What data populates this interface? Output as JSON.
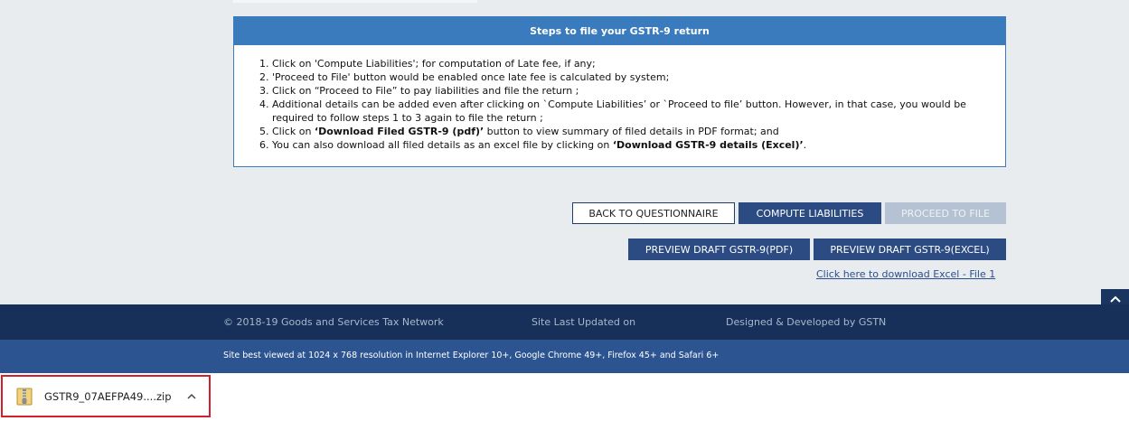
{
  "steps": {
    "title": "Steps to file your GSTR-9 return",
    "items": [
      {
        "pre": "Click on 'Compute Liabilities'; for computation of Late fee, if any;",
        "bold": "",
        "post": "",
        "bold2": "",
        "post2": ""
      },
      {
        "pre": "'Proceed to File' button would be enabled once late fee is calculated by system;",
        "bold": "",
        "post": "",
        "bold2": "",
        "post2": ""
      },
      {
        "pre": "Click on “Proceed to File” to pay liabilities and file the return ;",
        "bold": "",
        "post": "",
        "bold2": "",
        "post2": ""
      },
      {
        "pre": "Additional details can be added even after clicking on `Compute Liabilities’ or `Proceed to file’ button. However, in that case, you would be required to follow steps 1 to 3 again to file the return ;",
        "bold": "",
        "post": "",
        "bold2": "",
        "post2": ""
      },
      {
        "pre": "Click on ",
        "bold": "‘Download Filed GSTR-9 (pdf)’",
        "post": " button to view summary of filed details in PDF format; and",
        "bold2": "",
        "post2": ""
      },
      {
        "pre": "You can also download all filed details as an excel file by clicking on ",
        "bold": "‘Download GSTR-9 details (Excel)’",
        "post": ".",
        "bold2": "",
        "post2": ""
      }
    ]
  },
  "buttons": {
    "back": "BACK TO QUESTIONNAIRE",
    "compute": "COMPUTE LIABILITIES",
    "proceed": "PROCEED TO FILE",
    "preview_pdf": "PREVIEW DRAFT GSTR-9(PDF)",
    "preview_excel": "PREVIEW DRAFT GSTR-9(EXCEL)"
  },
  "download_link": "Click here to download Excel - File 1",
  "footer": {
    "copyright": "© 2018-19 Goods and Services Tax Network",
    "updated": "Site Last Updated on",
    "developed": "Designed & Developed by GSTN",
    "best_viewed": "Site best viewed at 1024 x 768 resolution in Internet Explorer 10+, Google Chrome 49+, Firefox 45+ and Safari 6+"
  },
  "download_bar": {
    "file_name": "GSTR9_07AEFPA49....zip",
    "file_icon": "zip-file-icon",
    "chevron_icon": "chevron-up-icon"
  },
  "colors": {
    "panel_header": "#3a7bbd",
    "primary_button": "#2b4b82",
    "footer_dark": "#17305a",
    "footer_blue": "#2c5491",
    "highlight_border": "#d3202f"
  }
}
